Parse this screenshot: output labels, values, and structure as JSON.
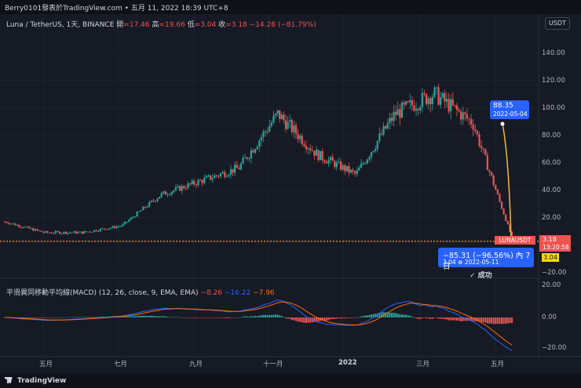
{
  "header": {
    "watermark": "Berry0101發表於TradingView.com • 五月 11, 2022 18:39 UTC+8"
  },
  "legend": {
    "symbol": "Luna / TetherUS, 1天, BINANCE",
    "open_label": "開",
    "open": "=17.46",
    "high_label": "高",
    "high": "=19.66",
    "low_label": "低",
    "low": "=3.04",
    "close_label": "收",
    "close": "=3.18",
    "change": "−14.28 (−81.79%)"
  },
  "currency_button": "USDT",
  "price_axis": {
    "ticks": [
      "140.00",
      "120.00",
      "100.00",
      "80.00",
      "60.00",
      "40.00",
      "20.00",
      "−20.00"
    ]
  },
  "macd": {
    "title": "平滑異同移動平均線(MACD) (12, 26, close, 9, EMA, EMA)",
    "v1": "−8.26",
    "v2": "−16.22",
    "v3": "−7.96",
    "ticks": [
      "20.00",
      "0.00",
      "−20.00"
    ]
  },
  "time_axis": [
    "五月",
    "七月",
    "九月",
    "十一月",
    "2022",
    "三月",
    "五月"
  ],
  "annotation_top": {
    "price": "88.35",
    "date": "2022-05-04"
  },
  "annotation_bottom": {
    "change": "−85.31 (−96.56%) 內 7日",
    "detail": "3.04 ⊗ 2022-05-11"
  },
  "success_label": "✓ 成功",
  "symbol_label": "LUNAUSDT",
  "last_price": {
    "price": "3.18",
    "countdown": "13:20:58"
  },
  "low_marker": "3.04",
  "footer": {
    "brand": "TradingView"
  },
  "chart_data": {
    "type": "candlestick",
    "symbol": "LUNAUSDT",
    "interval": "1D",
    "x": [
      "2021-05",
      "2021-06",
      "2021-07",
      "2021-08",
      "2021-09",
      "2021-10",
      "2021-11",
      "2021-12",
      "2022-01",
      "2022-02",
      "2022-03",
      "2022-04",
      "2022-05-04",
      "2022-05-11"
    ],
    "close_approx": [
      15,
      7,
      7,
      12,
      35,
      45,
      55,
      95,
      65,
      50,
      95,
      110,
      88.35,
      3.18
    ],
    "ylim": [
      -25,
      145
    ],
    "colors": {
      "up": "#26a69a",
      "down": "#ef5350",
      "annotation": "#f5b73b"
    }
  }
}
